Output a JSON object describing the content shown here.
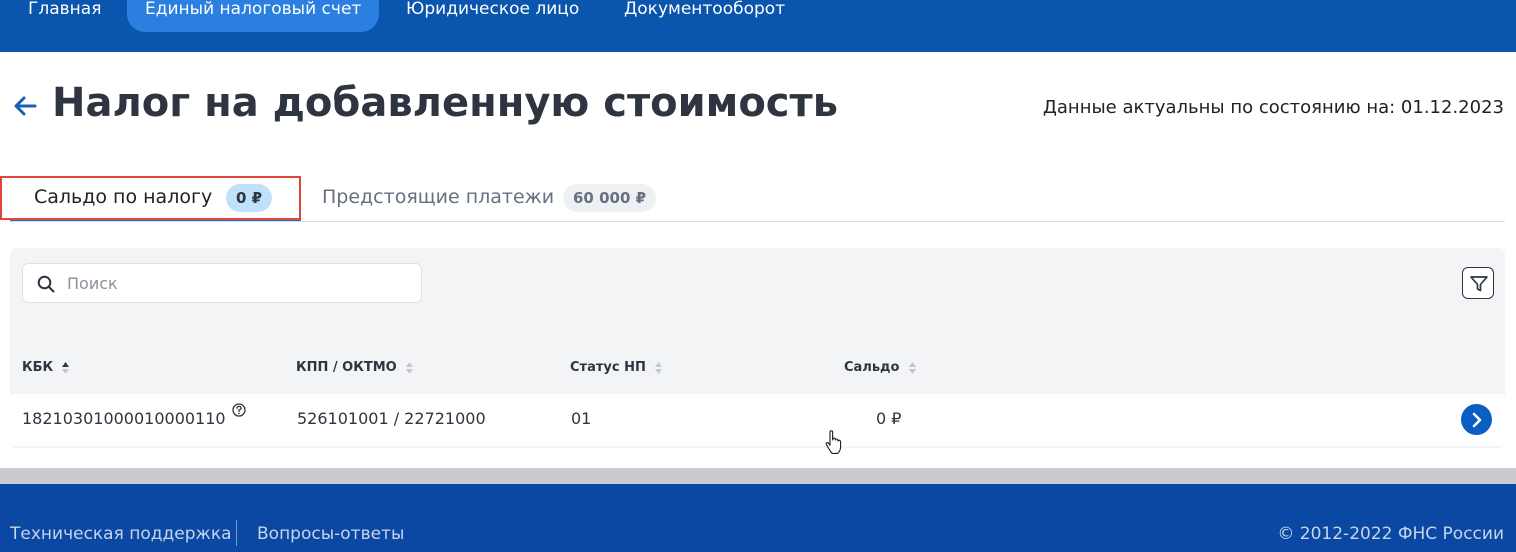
{
  "nav": {
    "items": [
      {
        "label": "Главная",
        "active": false
      },
      {
        "label": "Единый налоговый счет",
        "active": true
      },
      {
        "label": "Юридическое лицо",
        "active": false
      },
      {
        "label": "Документооборот",
        "active": false
      }
    ]
  },
  "header": {
    "back_icon": "arrow-left-icon",
    "title": "Налог на добавленную стоимость",
    "actual_date": "Данные актуальны по состоянию на: 01.12.2023"
  },
  "tabs": [
    {
      "label": "Сальдо по налогу",
      "badge": "0 ₽",
      "active": true
    },
    {
      "label": "Предстоящие платежи",
      "badge": "60 000 ₽",
      "active": false
    }
  ],
  "search": {
    "placeholder": "Поиск",
    "value": "",
    "icon": "search-icon"
  },
  "filter": {
    "icon": "filter-icon"
  },
  "table": {
    "columns": [
      "КБК",
      "КПП / ОКТМО",
      "Статус НП",
      "Сальдо"
    ],
    "rows": [
      {
        "kbk": "18210301000010000110",
        "kpp_oktmo": "526101001 / 22721000",
        "status": "01",
        "saldo": "0 ₽"
      }
    ]
  },
  "footer": {
    "links": [
      "Техническая поддержка",
      "Вопросы-ответы"
    ],
    "copyright": "© 2012-2022 ФНС России"
  },
  "colors": {
    "nav_bg": "#0a55ad",
    "nav_active": "#2b7fe0",
    "accent": "#2271cf",
    "footer_bg": "#0a48a3",
    "highlight": "#e0443b"
  }
}
